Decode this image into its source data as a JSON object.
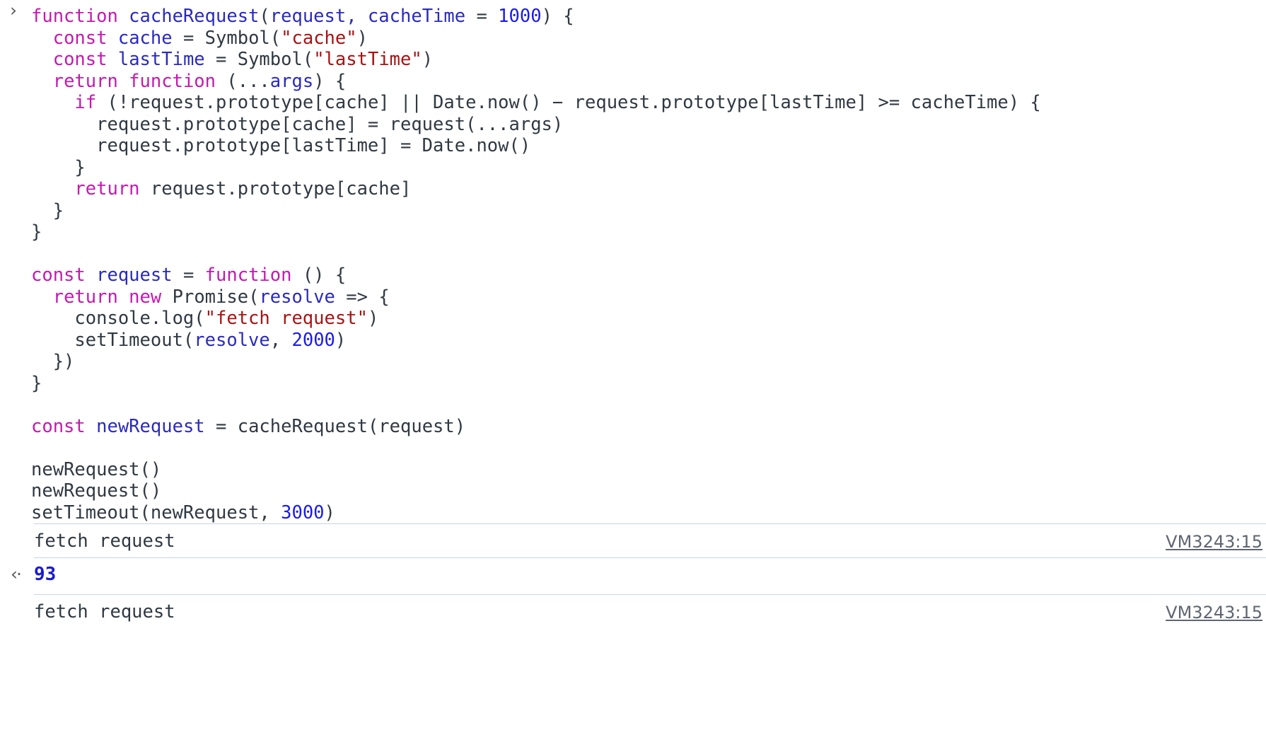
{
  "console": {
    "prompt_arrow": "›",
    "result_arrow": "‹·",
    "colors": {
      "background": "#ffffff",
      "plain_text": "#303942",
      "keyword": "#c519b0",
      "identifier": "#2a2ac0",
      "number": "#1a1aee",
      "string": "#a81414",
      "divider": "#c5d4ec",
      "link": "#5f6671",
      "result_value": "#1a1ad0",
      "gutter_arrow": "#5a5a5a"
    }
  },
  "input": {
    "lines": [
      [
        {
          "t": "function ",
          "c": "kw"
        },
        {
          "t": "cacheRequest",
          "c": "fn"
        },
        {
          "t": "(",
          "c": "pl"
        },
        {
          "t": "request, cacheTime",
          "c": "id"
        },
        {
          "t": " = ",
          "c": "pl"
        },
        {
          "t": "1000",
          "c": "num"
        },
        {
          "t": ") {",
          "c": "pl"
        }
      ],
      [
        {
          "t": "  ",
          "c": "pl"
        },
        {
          "t": "const ",
          "c": "kw"
        },
        {
          "t": "cache",
          "c": "id"
        },
        {
          "t": " = Symbol(",
          "c": "pl"
        },
        {
          "t": "\"cache\"",
          "c": "str"
        },
        {
          "t": ")",
          "c": "pl"
        }
      ],
      [
        {
          "t": "  ",
          "c": "pl"
        },
        {
          "t": "const ",
          "c": "kw"
        },
        {
          "t": "lastTime",
          "c": "id"
        },
        {
          "t": " = Symbol(",
          "c": "pl"
        },
        {
          "t": "\"lastTime\"",
          "c": "str"
        },
        {
          "t": ")",
          "c": "pl"
        }
      ],
      [
        {
          "t": "  ",
          "c": "pl"
        },
        {
          "t": "return function ",
          "c": "kw"
        },
        {
          "t": "(...",
          "c": "pl"
        },
        {
          "t": "args",
          "c": "id"
        },
        {
          "t": ") {",
          "c": "pl"
        }
      ],
      [
        {
          "t": "    ",
          "c": "pl"
        },
        {
          "t": "if ",
          "c": "kw"
        },
        {
          "t": "(!request.prototype[cache] || Date.now() − request.prototype[lastTime] >= cacheTime) {",
          "c": "pl"
        }
      ],
      [
        {
          "t": "      request.prototype[cache] = request(...args)",
          "c": "pl"
        }
      ],
      [
        {
          "t": "      request.prototype[lastTime] = Date.now()",
          "c": "pl"
        }
      ],
      [
        {
          "t": "    }",
          "c": "pl"
        }
      ],
      [
        {
          "t": "    ",
          "c": "pl"
        },
        {
          "t": "return ",
          "c": "kw"
        },
        {
          "t": "request.prototype[cache]",
          "c": "pl"
        }
      ],
      [
        {
          "t": "  }",
          "c": "pl"
        }
      ],
      [
        {
          "t": "}",
          "c": "pl"
        }
      ],
      [
        {
          "t": "",
          "c": "pl"
        }
      ],
      [
        {
          "t": "",
          "c": "pl"
        },
        {
          "t": "const ",
          "c": "kw"
        },
        {
          "t": "request",
          "c": "id"
        },
        {
          "t": " = ",
          "c": "pl"
        },
        {
          "t": "function ",
          "c": "kw"
        },
        {
          "t": "() {",
          "c": "pl"
        }
      ],
      [
        {
          "t": "  ",
          "c": "pl"
        },
        {
          "t": "return new ",
          "c": "kw"
        },
        {
          "t": "Promise(",
          "c": "pl"
        },
        {
          "t": "resolve",
          "c": "id"
        },
        {
          "t": " => {",
          "c": "pl"
        }
      ],
      [
        {
          "t": "    console.log(",
          "c": "pl"
        },
        {
          "t": "\"fetch request\"",
          "c": "str"
        },
        {
          "t": ")",
          "c": "pl"
        }
      ],
      [
        {
          "t": "    setTimeout(",
          "c": "pl"
        },
        {
          "t": "resolve",
          "c": "id"
        },
        {
          "t": ", ",
          "c": "pl"
        },
        {
          "t": "2000",
          "c": "num"
        },
        {
          "t": ")",
          "c": "pl"
        }
      ],
      [
        {
          "t": "  })",
          "c": "pl"
        }
      ],
      [
        {
          "t": "}",
          "c": "pl"
        }
      ],
      [
        {
          "t": "",
          "c": "pl"
        }
      ],
      [
        {
          "t": "",
          "c": "pl"
        },
        {
          "t": "const ",
          "c": "kw"
        },
        {
          "t": "newRequest",
          "c": "id"
        },
        {
          "t": " = cacheRequest(request)",
          "c": "pl"
        }
      ],
      [
        {
          "t": "",
          "c": "pl"
        }
      ],
      [
        {
          "t": "newRequest()",
          "c": "pl"
        }
      ],
      [
        {
          "t": "newRequest()",
          "c": "pl"
        }
      ],
      [
        {
          "t": "setTimeout(newRequest, ",
          "c": "pl"
        },
        {
          "t": "3000",
          "c": "num"
        },
        {
          "t": ")",
          "c": "pl"
        }
      ]
    ]
  },
  "output": {
    "rows": [
      {
        "kind": "log",
        "text": "fetch request",
        "source": "VM3243:15"
      },
      {
        "kind": "result",
        "value": "93"
      },
      {
        "kind": "log",
        "text": "fetch request",
        "source": "VM3243:15"
      }
    ]
  }
}
